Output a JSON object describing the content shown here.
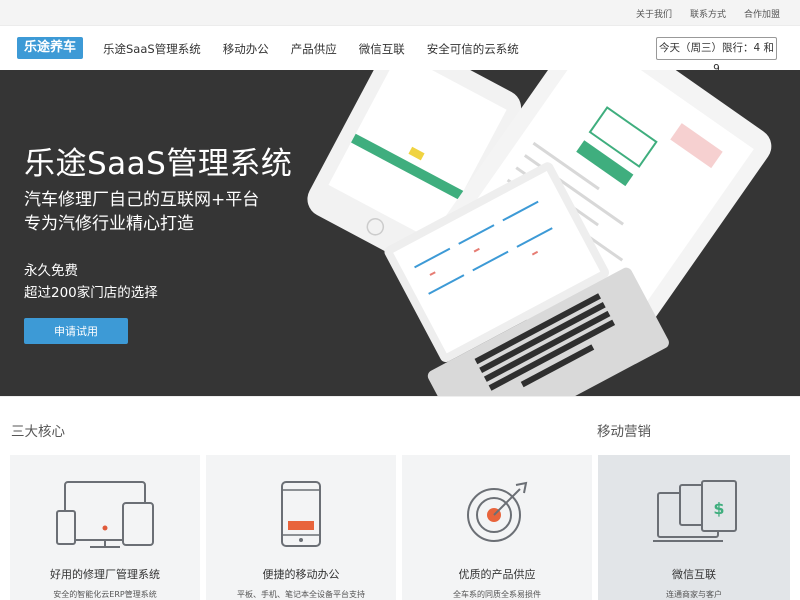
{
  "topbar": {
    "links": [
      "关于我们",
      "联系方式",
      "合作加盟"
    ]
  },
  "nav": {
    "logo": "乐途养车",
    "items": [
      "乐途SaaS管理系统",
      "移动办公",
      "产品供应",
      "微信互联",
      "安全可信的云系统"
    ],
    "limit_text": "今天（周三）限行：4 和 9"
  },
  "hero": {
    "title": "乐途SaaS管理系统",
    "subtitle_line1": "汽车修理厂自己的互联网+平台",
    "subtitle_line2": "专为汽修行业精心打造",
    "free_line1": "永久免费",
    "free_line2": "超过200家门店的选择",
    "apply_button": "申请试用"
  },
  "sections": {
    "core": "三大核心",
    "marketing": "移动营销"
  },
  "cards": [
    {
      "title": "好用的修理厂管理系统",
      "desc": "安全的智能化云ERP管理系统",
      "icon": "devices-icon"
    },
    {
      "title": "便捷的移动办公",
      "desc": "平板、手机、笔记本全设备平台支持",
      "icon": "phone-icon"
    },
    {
      "title": "优质的产品供应",
      "desc": "全车系的同质全系易损件",
      "icon": "target-icon"
    },
    {
      "title": "微信互联",
      "desc": "连通商家与客户",
      "icon": "wechat-devices-icon"
    }
  ],
  "colors": {
    "accent": "#3d9ad6",
    "hero_bg": "#353535",
    "card_bg": "#f3f4f5",
    "card_dark_bg": "#e2e5e8"
  }
}
